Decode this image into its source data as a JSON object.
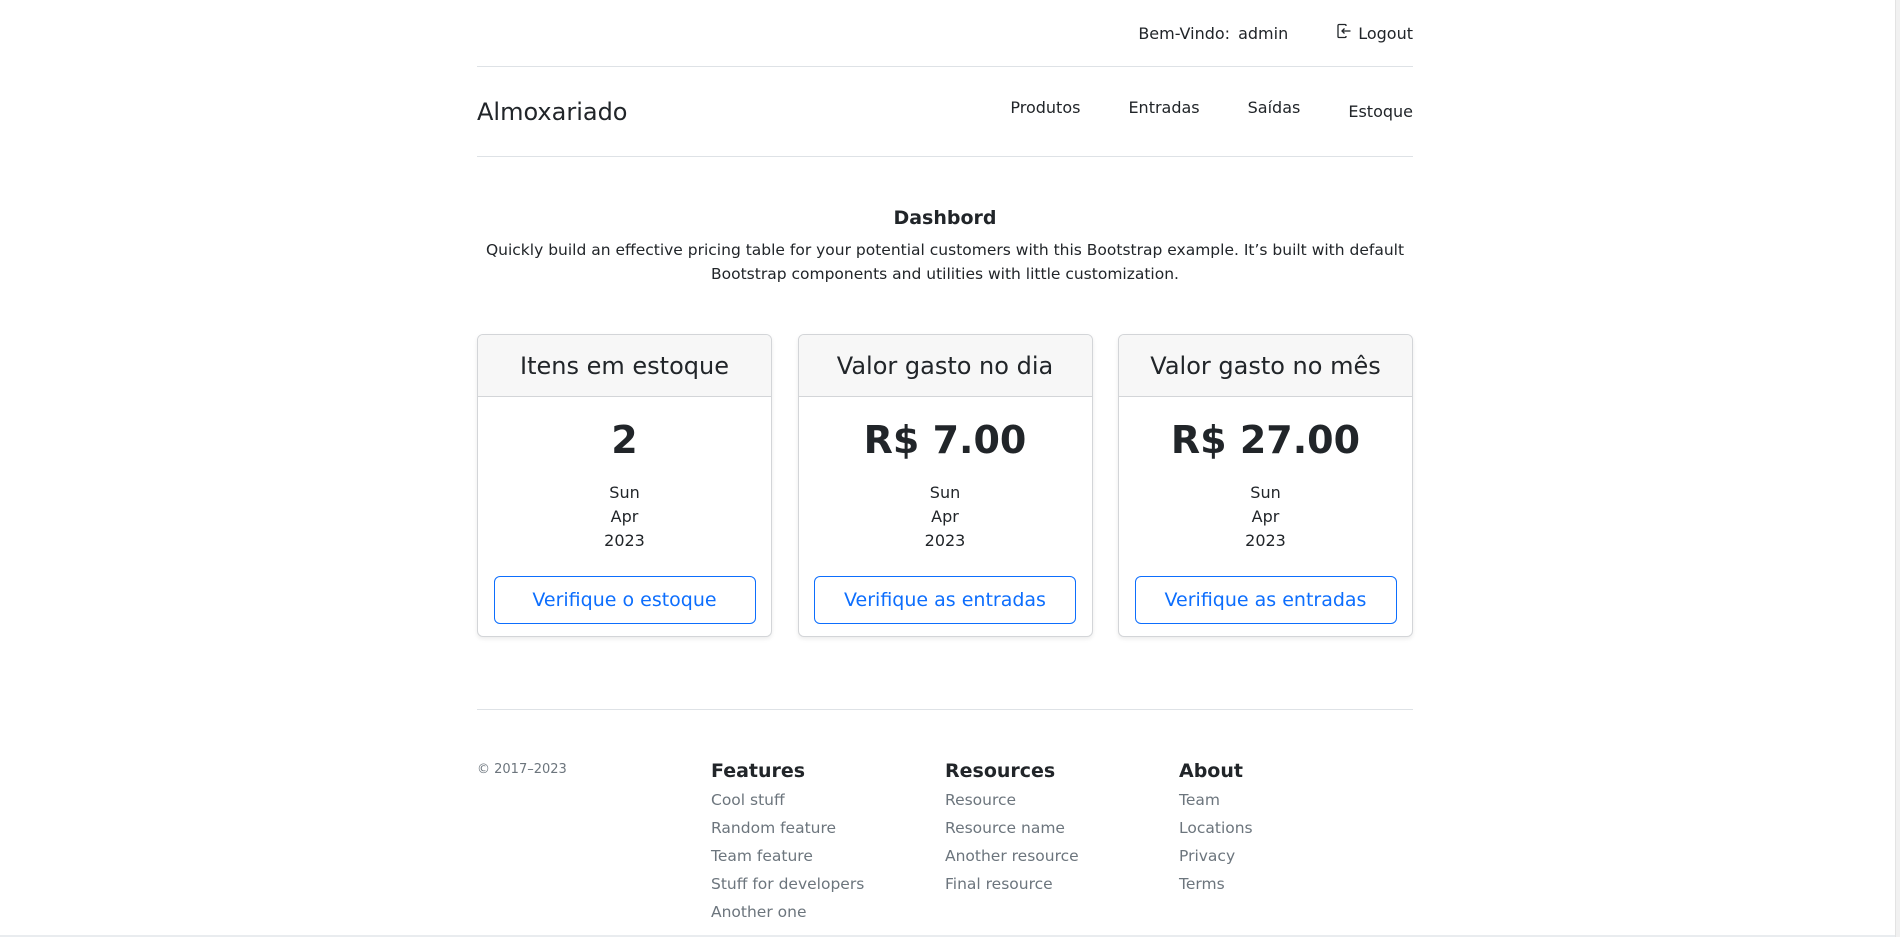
{
  "topbar": {
    "welcome_label": "Bem-Vindo:",
    "username": "admin",
    "logout_label": "Logout"
  },
  "navbar": {
    "brand": "Almoxariado",
    "links": [
      "Produtos",
      "Entradas",
      "Saídas",
      "Estoque"
    ]
  },
  "hero": {
    "title": "Dashbord",
    "description": "Quickly build an effective pricing table for your potential customers with this Bootstrap example. It’s built with default Bootstrap components and utilities with little customization."
  },
  "cards": [
    {
      "header": "Itens em estoque",
      "value": "2",
      "dates": [
        "Sun",
        "Apr",
        "2023"
      ],
      "button": "Verifique o estoque"
    },
    {
      "header": "Valor gasto no dia",
      "value": "R$ 7.00",
      "dates": [
        "Sun",
        "Apr",
        "2023"
      ],
      "button": "Verifique as entradas"
    },
    {
      "header": "Valor gasto no mês",
      "value": "R$ 27.00",
      "dates": [
        "Sun",
        "Apr",
        "2023"
      ],
      "button": "Verifique as entradas"
    }
  ],
  "footer": {
    "copyright": "© 2017–2023",
    "columns": [
      {
        "title": "Features",
        "links": [
          "Cool stuff",
          "Random feature",
          "Team feature",
          "Stuff for developers",
          "Another one"
        ]
      },
      {
        "title": "Resources",
        "links": [
          "Resource",
          "Resource name",
          "Another resource",
          "Final resource"
        ]
      },
      {
        "title": "About",
        "links": [
          "Team",
          "Locations",
          "Privacy",
          "Terms"
        ]
      }
    ]
  },
  "colors": {
    "primary": "#0d6efd",
    "text": "#212529",
    "muted": "#6c757d",
    "border": "#dee2e6",
    "card_header_bg": "#f7f7f7"
  },
  "icons": {
    "logout": "logout-icon"
  }
}
